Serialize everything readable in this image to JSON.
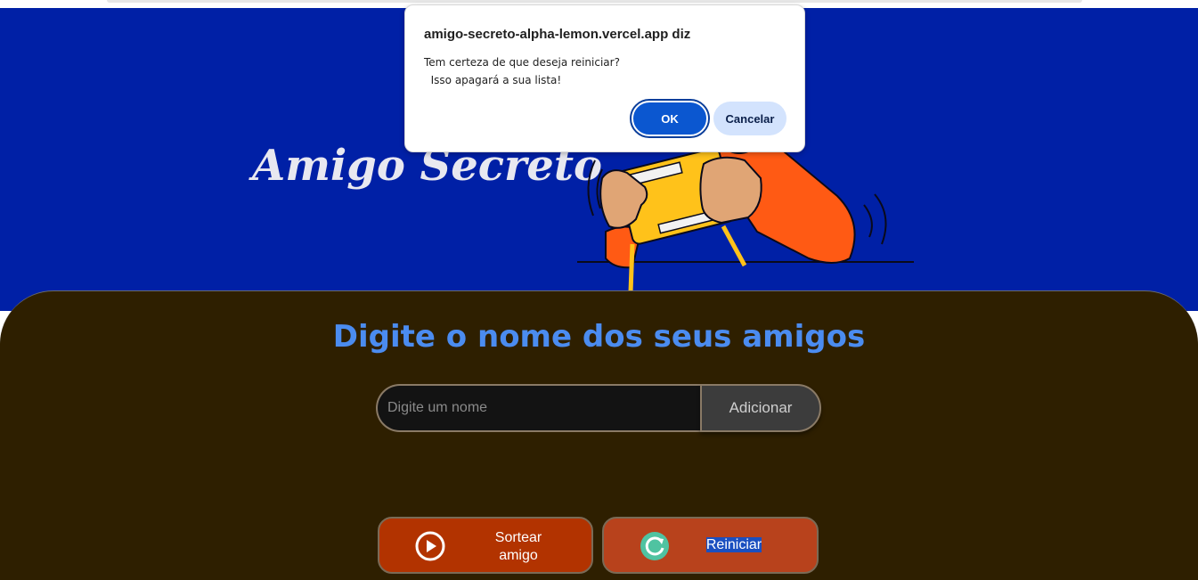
{
  "header": {
    "title": "Amigo Secreto",
    "illustration": "person-playing-handheld-game-illustration"
  },
  "main": {
    "heading": "Digite o nome dos seus amigos",
    "name_input": {
      "placeholder": "Digite um nome",
      "value": ""
    },
    "add_button": "Adicionar",
    "draw_button": {
      "label_line1": "Sortear",
      "label_line2": "amigo",
      "icon": "play-circle-icon"
    },
    "restart_button": {
      "label": "Reiniciar",
      "icon": "restart-icon"
    }
  },
  "dialog": {
    "origin": "amigo-secreto-alpha-lemon.vercel.app diz",
    "message_line1": "Tem certeza de que deseja reiniciar?",
    "message_line2": "  Isso apagará a sua lista!",
    "ok_label": "OK",
    "cancel_label": "Cancelar"
  },
  "colors": {
    "header_bg": "#0020a6",
    "main_bg": "#2e1f00",
    "heading": "#4b8cf0",
    "draw_button": "#b23300",
    "restart_button": "#b8421c",
    "dialog_ok": "#0b57d0",
    "dialog_cancel": "#d3e3fd"
  }
}
